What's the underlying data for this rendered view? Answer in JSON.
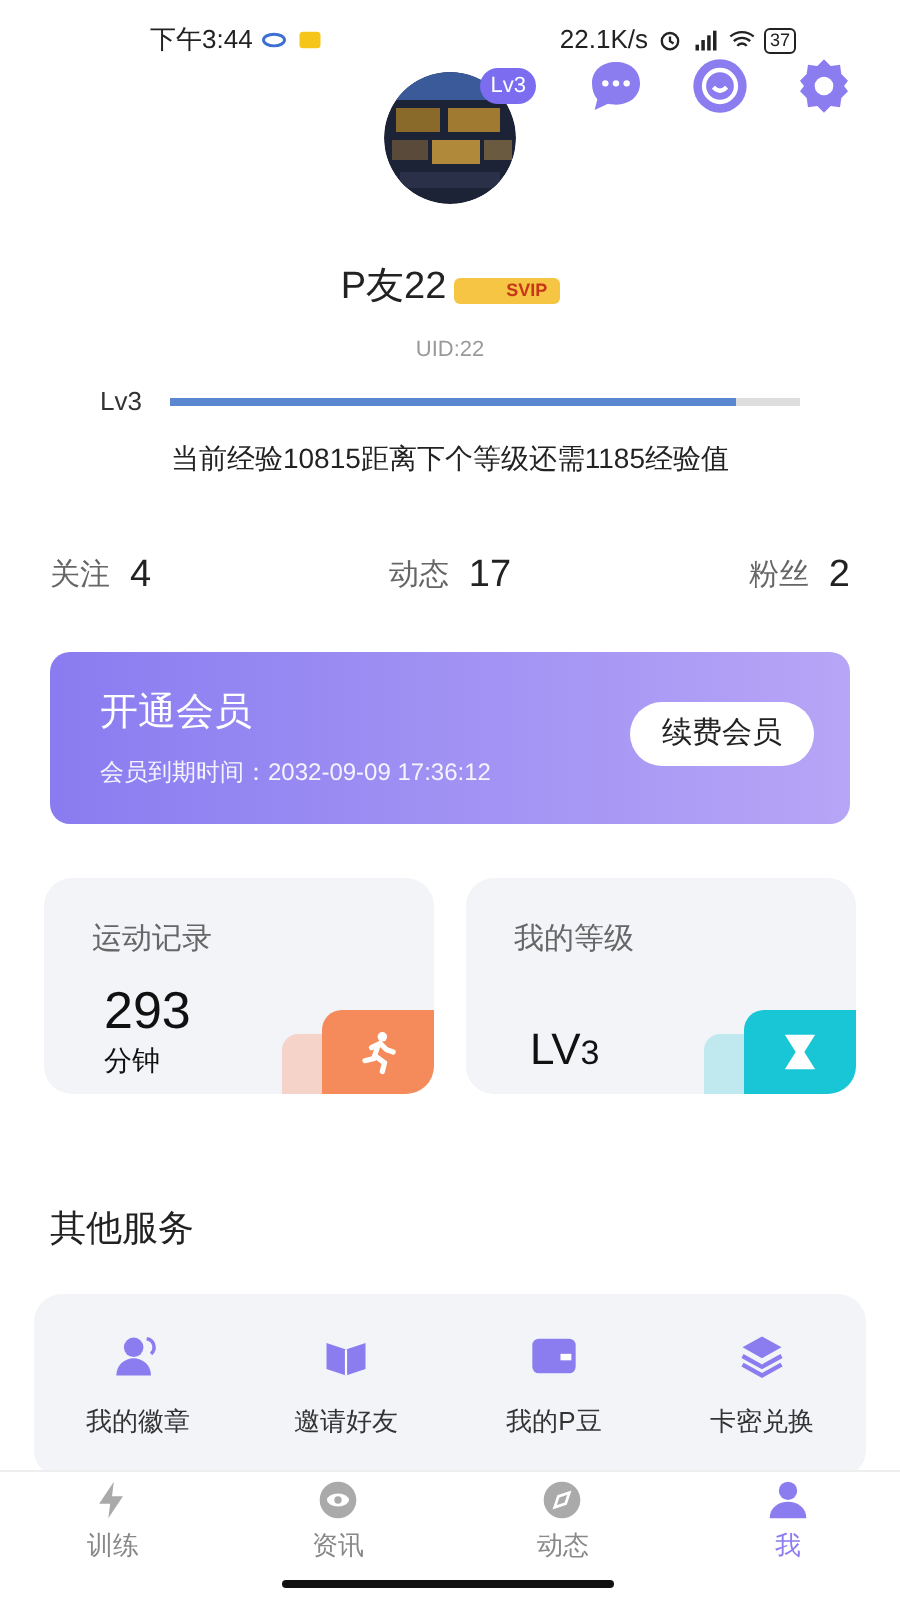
{
  "status_bar": {
    "time": "下午3:44",
    "speed": "22.1K/s",
    "battery": "37"
  },
  "profile": {
    "level_badge": "Lv3",
    "name": "P友22",
    "vip_badge": "SVIP",
    "uid": "UID:22",
    "level_label": "Lv3",
    "level": 0.9,
    "exp_text": "当前经验10815距离下个等级还需1185经验值"
  },
  "stats": [
    {
      "label": "关注",
      "value": "4"
    },
    {
      "label": "动态",
      "value": "17"
    },
    {
      "label": "粉丝",
      "value": "2"
    }
  ],
  "vip_card": {
    "title": "开通会员",
    "expiry": "会员到期时间：2032-09-09 17:36:12",
    "button": "续费会员"
  },
  "cards": [
    {
      "kind": "exercise",
      "title": "运动记录",
      "value": "293",
      "unit": "分钟"
    },
    {
      "kind": "level",
      "title": "我的等级",
      "value": "LV",
      "value_suffix": "3"
    }
  ],
  "services": {
    "title": "其他服务",
    "items": [
      {
        "kind": "badge",
        "label": "我的徽章"
      },
      {
        "kind": "invite",
        "label": "邀请好友"
      },
      {
        "kind": "wallet",
        "label": "我的P豆"
      },
      {
        "kind": "layers",
        "label": "卡密兑换"
      }
    ]
  },
  "tabs": [
    {
      "kind": "train",
      "label": "训练",
      "selected": false
    },
    {
      "kind": "news",
      "label": "资讯",
      "selected": false
    },
    {
      "kind": "feed",
      "label": "动态",
      "selected": false
    },
    {
      "kind": "me",
      "label": "我",
      "selected": true
    }
  ]
}
